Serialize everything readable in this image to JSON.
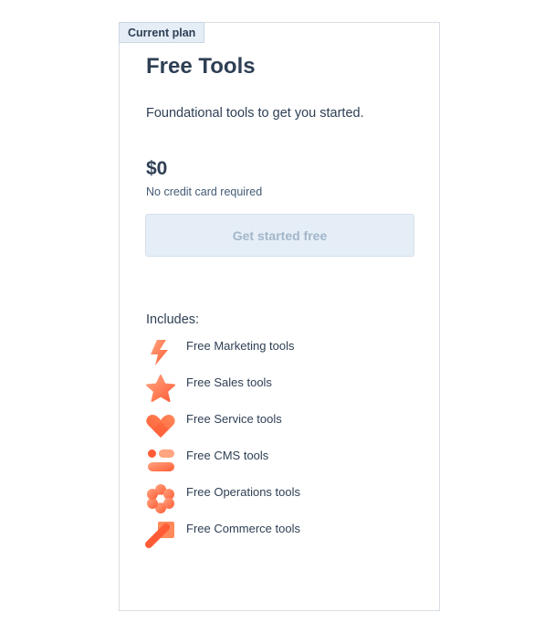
{
  "plan": {
    "badge": "Current plan",
    "title": "Free Tools",
    "description": "Foundational tools to get you started.",
    "price": "$0",
    "price_note": "No credit card required",
    "cta_label": "Get started free",
    "includes_label": "Includes:",
    "features": [
      {
        "label": "Free Marketing tools",
        "icon": "marketing-icon"
      },
      {
        "label": "Free Sales tools",
        "icon": "sales-icon"
      },
      {
        "label": "Free Service tools",
        "icon": "service-icon"
      },
      {
        "label": "Free CMS tools",
        "icon": "cms-icon"
      },
      {
        "label": "Free Operations tools",
        "icon": "operations-icon"
      },
      {
        "label": "Free Commerce tools",
        "icon": "commerce-icon"
      }
    ]
  },
  "colors": {
    "text": "#2e3f54",
    "badge_bg": "#e5eef7",
    "button_bg": "#e5eef7",
    "button_text": "#a3b6c9",
    "icon_orange": "#ff5c35",
    "icon_light": "#ffa581"
  }
}
